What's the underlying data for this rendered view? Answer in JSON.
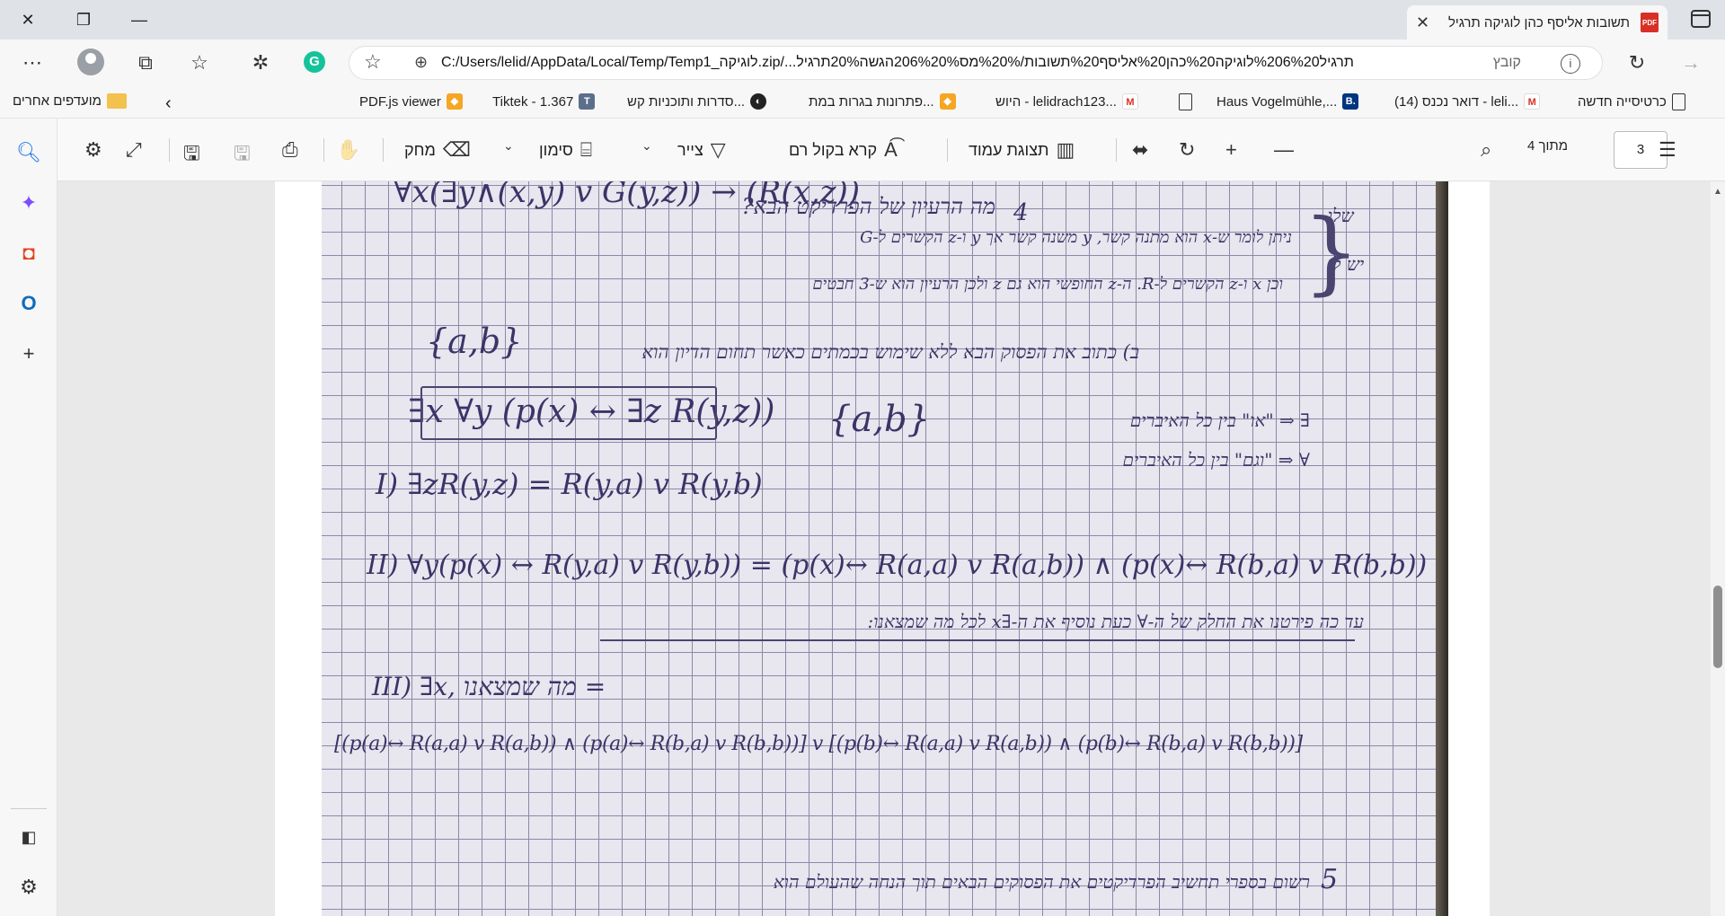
{
  "window": {
    "tab_title": "תשובות אליסף כהן לוגיקה תרגיל",
    "tab_icon": "pdf-icon",
    "tab_icon_text": "PDF",
    "minimize": "—",
    "restore": "❐",
    "close": "✕"
  },
  "address_bar": {
    "file_label": "קובץ",
    "url": "C:/Users/lelid/AppData/Local/Temp/Temp1_לוגיקה.zip/...תרגיל%206%20לוגיקה%20כהן%20אליסף%20תשובות/%20%מס206%20%הגשה20%תרגיל"
  },
  "bookmarks": {
    "items": [
      {
        "label": "כרטיסייה חדשה",
        "icon": "page-icon"
      },
      {
        "label": "דואר נכנס (14) - leli...",
        "icon": "gmail-icon"
      },
      {
        "label": "Haus Vogelmühle,...",
        "icon": "booking-icon"
      },
      {
        "label": "",
        "icon": "page-icon"
      },
      {
        "label": "היוש - lelidrach123...",
        "icon": "gmail-icon"
      },
      {
        "label": "פתרונות בגרות במת...",
        "icon": "orange-icon"
      },
      {
        "label": "סדרות ותוכניות קש...",
        "icon": "circle-icon"
      },
      {
        "label": "Tiktek - 1.367",
        "icon": "tiktek-icon"
      },
      {
        "label": "PDF.js viewer",
        "icon": "orange-icon"
      }
    ],
    "other": "מועדפים אחרים"
  },
  "pdf_toolbar": {
    "page_current": "3",
    "page_total": "מתוך 4",
    "page_view": "תצוגת עמוד",
    "read_aloud": "קרא בקול רם",
    "draw": "צייר",
    "highlight": "סימון",
    "erase": "מחק"
  },
  "handwriting": {
    "line1": "∀x(∃y∧(x,y) v G(y,z)) → (R(x,z))",
    "q4_mark": "4",
    "q4": "מה הרעיון של הפרדיקט הבא?",
    "ans1": "ניתן לומר ש-x הוא מתנה קשר, y משנה קשר אך y ו-z הקשרים ל-G",
    "ans2": "וכן x ו-z הקשרים ל-R. ה-z החופשי הוא גם z ולכן הרעיון הוא ש-3 חבטים",
    "margin1": "שלו",
    "margin2": "יש לו",
    "domain1": "{a,b}",
    "part_b": "ב) כתוב את הפסוק הבא ללא שימוש בכמתים כאשר תחום הדיון הוא",
    "formula": "∃x ∀y (p(x) ↔ ∃z R(y,z))",
    "domain2": "{a,b}",
    "exists_note": "∃ ⇒ \"או\" בין כל האיברים",
    "forall_note": "∀ ⇒ \"וגם\" בין כל האיברים",
    "step1": "I) ∃zR(y,z) = R(y,a) v R(y,b)",
    "step2": "II) ∀y(p(x) ↔ R(y,a) v R(y,b)) = (p(x)↔ R(a,a) v R(a,b)) ∧ (p(x)↔ R(b,a) v R(b,b))",
    "step2_note": "עד כה פירטנו את החלק של ה-∀ כעת נוסיף את ה-∃x לכל מה שמצאנו:",
    "step3": "III) ∃x, מה שמצאנו =",
    "step3_full": "[(p(a)↔ R(a,a) v R(a,b)) ∧ (p(a)↔ R(b,a) v R(b,b))] v [(p(b)↔ R(a,a) v R(a,b)) ∧ (p(b)↔ R(b,a) v R(b,b))]",
    "q5_mark": "5",
    "q5": "רשום בספרי תחשיב הפרדיקטים את הפסוקים הבאים תוך הנחה שהעולם הוא"
  }
}
